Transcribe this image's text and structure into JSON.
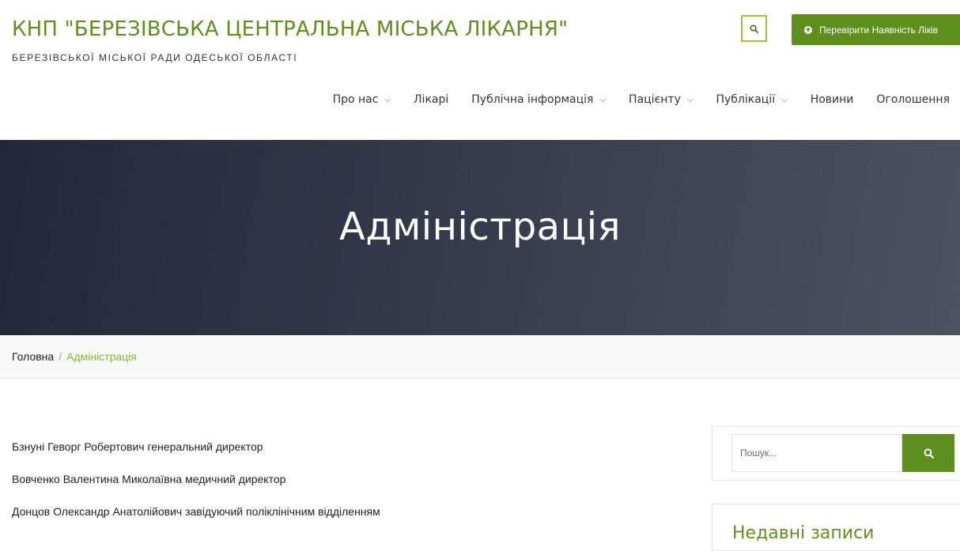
{
  "header": {
    "site_title": "КНП \"БЕРЕЗІВСЬКА ЦЕНТРАЛЬНА МІСЬКА ЛІКАРНЯ\"",
    "site_tagline": "БЕРЕЗІВСЬКОЇ МІСЬКОЇ РАДИ ОДЕСЬКОЇ ОБЛАСТІ",
    "search_icon": "search-icon",
    "cta_label": "Перевірити Наявність Ліків",
    "cta_icon": "arrow-circle-icon"
  },
  "nav": {
    "items": [
      {
        "label": "Про нас",
        "caret": "›"
      },
      {
        "label": "Лікарі",
        "caret": ""
      },
      {
        "label": "Публічна інформація",
        "caret": "›"
      },
      {
        "label": "Пацієнту",
        "caret": "›"
      },
      {
        "label": "Публікації",
        "caret": "›"
      },
      {
        "label": "Новини",
        "caret": ""
      },
      {
        "label": "Оголошення",
        "caret": ""
      }
    ]
  },
  "hero": {
    "title": "Адміністрація"
  },
  "breadcrumb": {
    "home": "Головна",
    "separator": "/",
    "current": "Адміністрація"
  },
  "staff": [
    "Бзнуні Геворг Робертович генеральний директор",
    "Вовченко Валентина Миколаївна медичний директор",
    "Донцов Олександр Анатолійович завідуючий поліклінічним відділенням"
  ],
  "sidebar": {
    "search_placeholder": "Пошук...",
    "search_icon": "search-icon",
    "recent_title": "Недавні записи"
  },
  "colors": {
    "brand_green": "#5f8f1f",
    "accent_lime": "#8cb62a",
    "hero_dark": "#22283a"
  }
}
